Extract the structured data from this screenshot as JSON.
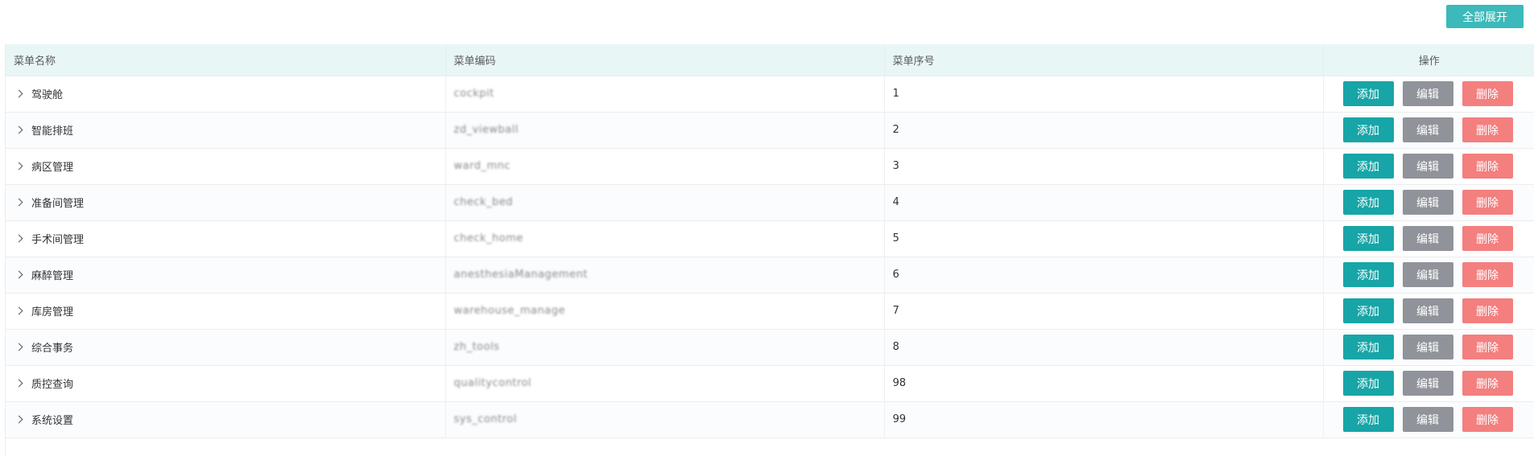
{
  "toolbar": {
    "expand_all_label": "全部展开",
    "expand_all_color": "#3cb9ba"
  },
  "table": {
    "headers": {
      "name": "菜单名称",
      "code": "菜单编码",
      "order": "菜单序号",
      "ops": "操作"
    },
    "action_labels": {
      "add": "添加",
      "edit": "编辑",
      "delete": "删除"
    },
    "colors": {
      "header_bg": "#e9f6f6",
      "add": "#17a5a7",
      "edit": "#909399",
      "delete": "#f47f7f"
    },
    "rows": [
      {
        "name": "驾驶舱",
        "code": "cockpit",
        "order": "1"
      },
      {
        "name": "智能排班",
        "code": "zd_viewball",
        "order": "2"
      },
      {
        "name": "病区管理",
        "code": "ward_mnc",
        "order": "3"
      },
      {
        "name": "准备间管理",
        "code": "check_bed",
        "order": "4"
      },
      {
        "name": "手术间管理",
        "code": "check_home",
        "order": "5"
      },
      {
        "name": "麻醉管理",
        "code": "anesthesiaManagement",
        "order": "6"
      },
      {
        "name": "库房管理",
        "code": "warehouse_manage",
        "order": "7"
      },
      {
        "name": "综合事务",
        "code": "zh_tools",
        "order": "8"
      },
      {
        "name": "质控查询",
        "code": "qualitycontrol",
        "order": "98"
      },
      {
        "name": "系统设置",
        "code": "sys_control",
        "order": "99"
      }
    ]
  }
}
